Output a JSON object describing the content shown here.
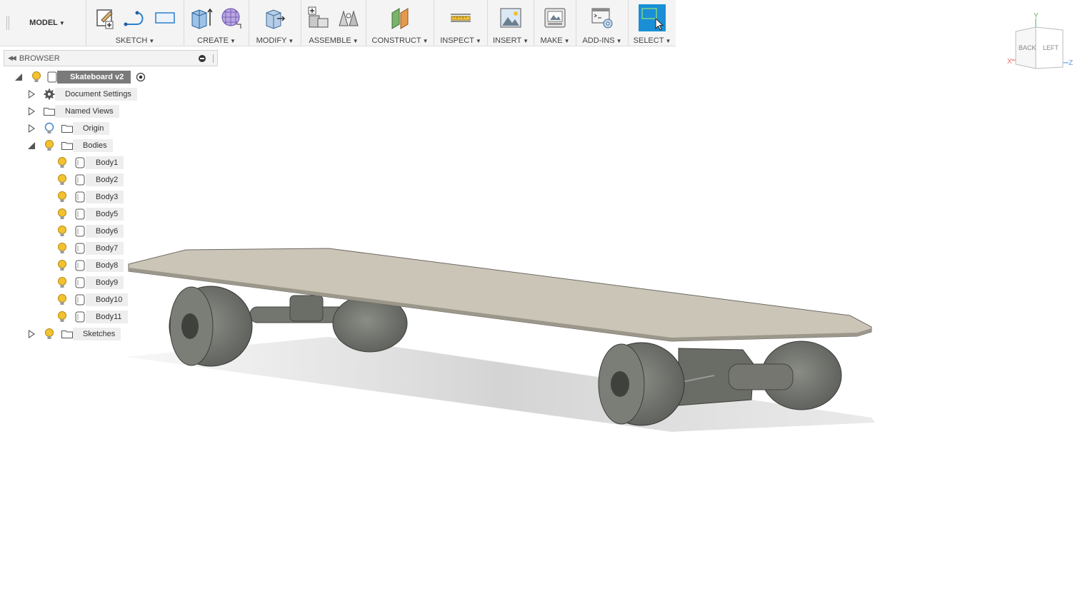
{
  "toolbar": {
    "workspace": "MODEL",
    "groups": [
      {
        "label": "SKETCH"
      },
      {
        "label": "CREATE"
      },
      {
        "label": "MODIFY"
      },
      {
        "label": "ASSEMBLE"
      },
      {
        "label": "CONSTRUCT"
      },
      {
        "label": "INSPECT"
      },
      {
        "label": "INSERT"
      },
      {
        "label": "MAKE"
      },
      {
        "label": "ADD-INS"
      },
      {
        "label": "SELECT"
      }
    ]
  },
  "browser": {
    "title": "BROWSER",
    "root": "Skateboard v2",
    "items": {
      "document_settings": "Document Settings",
      "named_views": "Named Views",
      "origin": "Origin",
      "bodies": "Bodies",
      "sketches": "Sketches"
    },
    "bodies": [
      "Body1",
      "Body2",
      "Body3",
      "Body5",
      "Body6",
      "Body7",
      "Body8",
      "Body9",
      "Body10",
      "Body11"
    ]
  },
  "viewcube": {
    "axis_y": "Y",
    "axis_x": "X",
    "axis_z": "Z",
    "face_back": "BACK",
    "face_left": "LEFT"
  },
  "colors": {
    "select_accent": "#1a8fd6",
    "bulb": "#f2c230",
    "deck": "#cbc5b8",
    "wheel": "#6e706a"
  }
}
